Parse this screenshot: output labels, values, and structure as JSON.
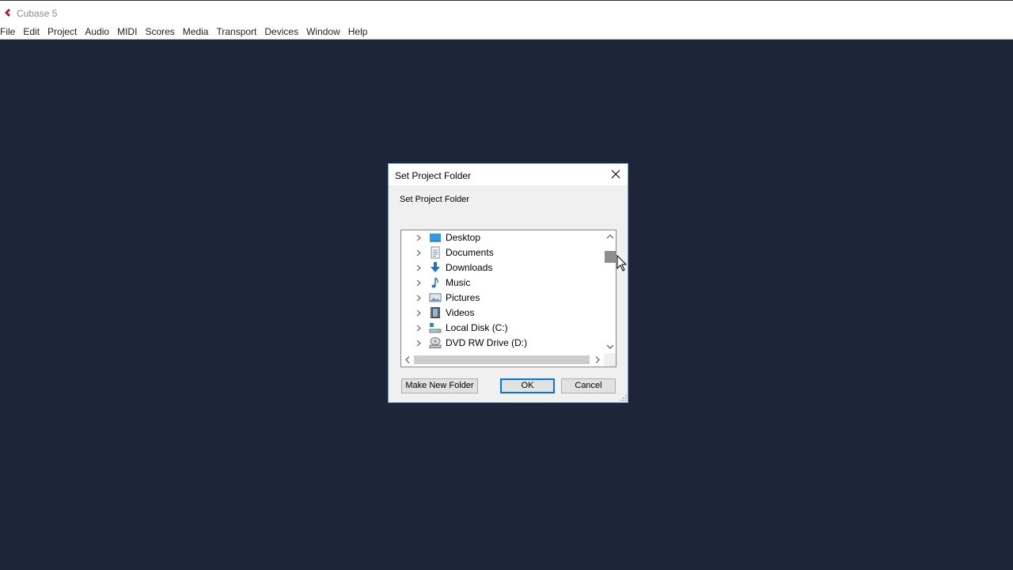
{
  "app": {
    "title": "Cubase 5",
    "logo_icon": "cubase-logo-icon",
    "logo_color": "#b0172f"
  },
  "menubar": {
    "items": [
      "File",
      "Edit",
      "Project",
      "Audio",
      "MIDI",
      "Scores",
      "Media",
      "Transport",
      "Devices",
      "Window",
      "Help"
    ]
  },
  "dialog": {
    "title": "Set Project Folder",
    "description": "Set Project Folder",
    "close_icon": "close-icon",
    "tree": {
      "items": [
        {
          "label": "Desktop",
          "icon": "desktop-folder-icon"
        },
        {
          "label": "Documents",
          "icon": "documents-folder-icon"
        },
        {
          "label": "Downloads",
          "icon": "downloads-folder-icon"
        },
        {
          "label": "Music",
          "icon": "music-folder-icon"
        },
        {
          "label": "Pictures",
          "icon": "pictures-folder-icon"
        },
        {
          "label": "Videos",
          "icon": "videos-folder-icon"
        },
        {
          "label": "Local Disk (C:)",
          "icon": "local-disk-icon"
        },
        {
          "label": "DVD RW Drive (D:)",
          "icon": "dvd-drive-icon"
        }
      ]
    },
    "buttons": {
      "make_new_folder": "Make New Folder",
      "ok": "OK",
      "cancel": "Cancel"
    }
  },
  "colors": {
    "workspace_bg": "#1c2638",
    "dialog_border": "#6d9bd1",
    "default_button_border": "#0078d7"
  }
}
